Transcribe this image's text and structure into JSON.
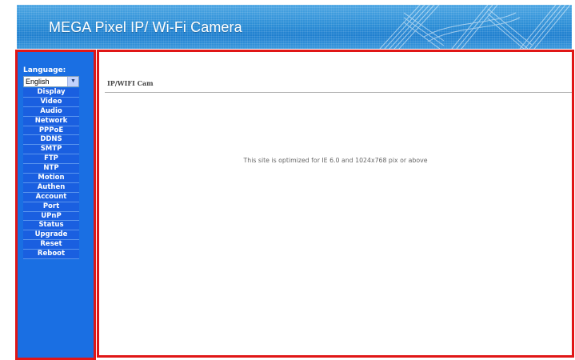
{
  "header": {
    "title": "MEGA Pixel IP/ Wi-Fi Camera"
  },
  "sidebar": {
    "language_label": "Language:",
    "language_value": "English",
    "items": [
      "Display",
      "Video",
      "Audio",
      "Network",
      "PPPoE",
      "DDNS",
      "SMTP",
      "FTP",
      "NTP",
      "Motion",
      "Authen",
      "Account",
      "Port",
      "UPnP",
      "Status",
      "Upgrade",
      "Reset",
      "Reboot"
    ]
  },
  "main": {
    "title": "IP/WIFI Cam",
    "message": "This site is optimized for IE 6.0 and 1024x768 pix or above"
  },
  "colors": {
    "sidebar_bg": "#1a6fe3",
    "border_highlight": "#e01616",
    "banner": "#2c8ed6"
  }
}
